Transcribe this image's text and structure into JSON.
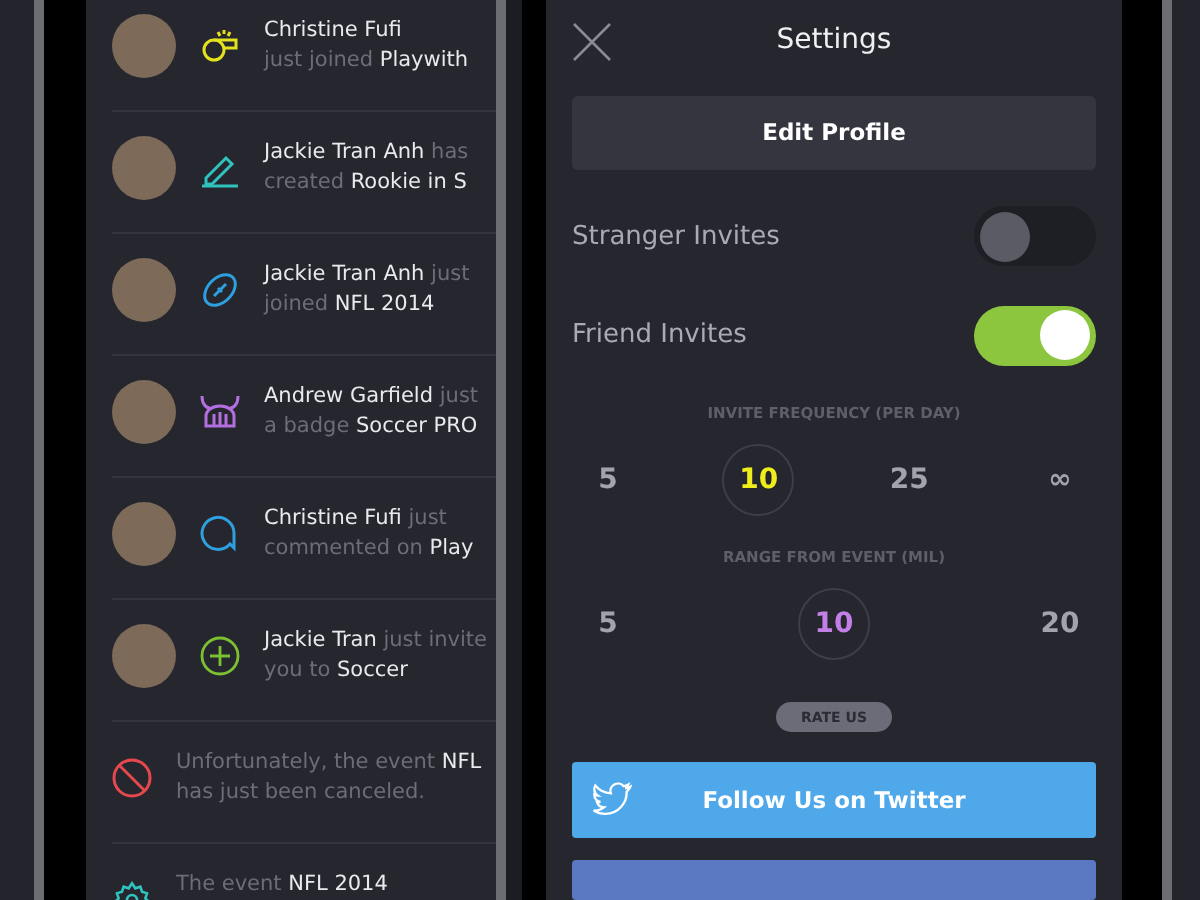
{
  "activity": [
    {
      "kind": "whistle",
      "color": "#e4e21c",
      "avatar": true,
      "lines": [
        "**Christine Fufi**",
        "just joined **Playwith**"
      ]
    },
    {
      "kind": "pencil",
      "color": "#2fc3bd",
      "avatar": true,
      "lines": [
        "**Jackie Tran Anh** has",
        "created **Rookie in S**"
      ]
    },
    {
      "kind": "football",
      "color": "#2ea0e0",
      "avatar": true,
      "lines": [
        "**Jackie Tran Anh** just",
        "joined **NFL 2014**"
      ]
    },
    {
      "kind": "helmet",
      "color": "#b36ee0",
      "avatar": true,
      "lines": [
        "**Andrew Garfield** just",
        "a badge **Soccer PRO**"
      ]
    },
    {
      "kind": "comment",
      "color": "#2ea0e0",
      "avatar": true,
      "lines": [
        "**Christine Fufi** just",
        "commented on **Play**"
      ]
    },
    {
      "kind": "invite",
      "color": "#7cc132",
      "avatar": true,
      "lines": [
        "**Jackie Tran** just invite",
        "you to **Soccer**"
      ]
    },
    {
      "kind": "canceled",
      "color": "#e5484d",
      "avatar": false,
      "lines": [
        "Unfortunately, the event **NFL**",
        "has just been canceled."
      ]
    },
    {
      "kind": "gear",
      "color": "#2fc3bd",
      "avatar": false,
      "lines": [
        "The event **NFL 2014**"
      ]
    }
  ],
  "settings": {
    "title": "Settings",
    "edit_profile": "Edit Profile",
    "toggles": [
      {
        "label": "Stranger Invites",
        "checked": false
      },
      {
        "label": "Friend Invites",
        "checked": true
      }
    ],
    "pickers": [
      {
        "label": "INVITE FREQUENCY (PER DAY)",
        "color": "#f0ee1a",
        "options": [
          {
            "label": "5",
            "selected": false
          },
          {
            "label": "10",
            "selected": true
          },
          {
            "label": "25",
            "selected": false
          },
          {
            "label": "∞",
            "selected": false
          }
        ]
      },
      {
        "label": "RANGE FROM EVENT (MIL)",
        "color": "#c27fe6",
        "options": [
          {
            "label": "5",
            "selected": false
          },
          {
            "label": "10",
            "selected": true
          },
          {
            "label": "20",
            "selected": false
          }
        ]
      }
    ],
    "rate_us": "RATE US",
    "twitter": "Follow Us on Twitter"
  }
}
